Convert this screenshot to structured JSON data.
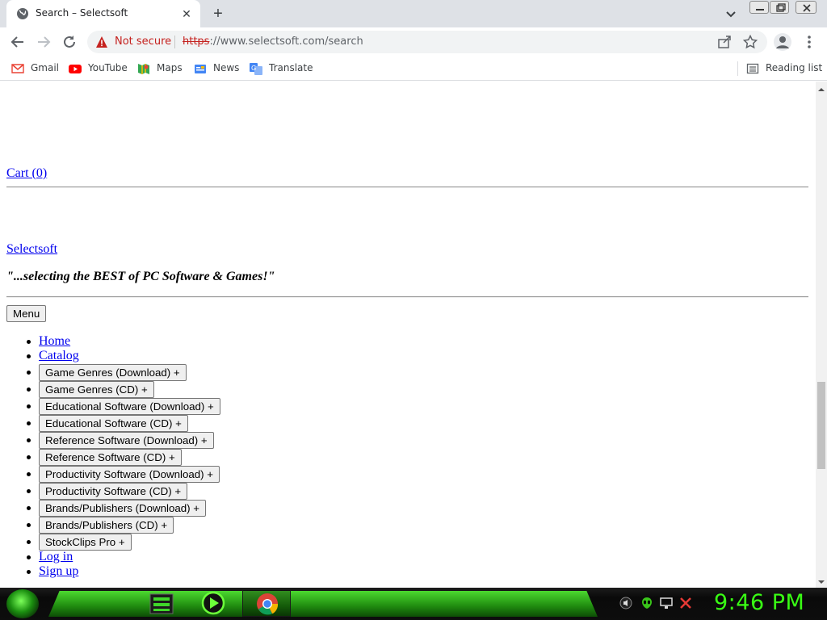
{
  "browser": {
    "tab_title": "Search – Selectsoft",
    "new_tab_symbol": "+",
    "close_symbol": "✕",
    "security_label": "Not secure",
    "url_scheme": "https",
    "url_rest": "://www.selectsoft.com/search",
    "bookmarks": [
      {
        "label": "Gmail",
        "icon": "gmail-icon"
      },
      {
        "label": "YouTube",
        "icon": "youtube-icon"
      },
      {
        "label": "Maps",
        "icon": "maps-icon"
      },
      {
        "label": "News",
        "icon": "news-icon"
      },
      {
        "label": "Translate",
        "icon": "translate-icon"
      }
    ],
    "reading_list": "Reading list"
  },
  "page": {
    "cart_link": "Cart (0)",
    "logo_alt": "Selectsoft",
    "tagline": "\"...selecting the BEST of PC Software & Games!\"",
    "menu_button": "Menu",
    "nav": [
      {
        "type": "link",
        "label": "Home"
      },
      {
        "type": "link",
        "label": "Catalog"
      },
      {
        "type": "button",
        "label": "Game Genres (Download) +"
      },
      {
        "type": "button",
        "label": "Game Genres (CD) +"
      },
      {
        "type": "button",
        "label": "Educational Software (Download) +"
      },
      {
        "type": "button",
        "label": "Educational Software (CD) +"
      },
      {
        "type": "button",
        "label": "Reference Software (Download) +"
      },
      {
        "type": "button",
        "label": "Reference Software (CD) +"
      },
      {
        "type": "button",
        "label": "Productivity Software (Download) +"
      },
      {
        "type": "button",
        "label": "Productivity Software (CD) +"
      },
      {
        "type": "button",
        "label": "Brands/Publishers (Download) +"
      },
      {
        "type": "button",
        "label": "Brands/Publishers (CD) +"
      },
      {
        "type": "button",
        "label": "StockClips Pro +"
      },
      {
        "type": "link",
        "label": "Log in"
      },
      {
        "type": "link",
        "label": "Sign up"
      }
    ]
  },
  "taskbar": {
    "clock": "9:46 PM",
    "accent_color": "#39ff14"
  }
}
